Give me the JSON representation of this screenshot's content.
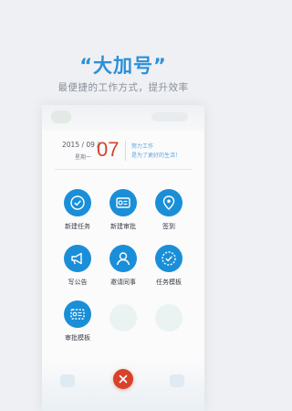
{
  "header": {
    "title": "“大加号”",
    "subtitle": "最便捷的工作方式，提升效率"
  },
  "date": {
    "year_month": "2015 / 09 /",
    "weekday": "星期一",
    "day": "07",
    "motto_line1": "努力工作",
    "motto_line2": "是为了更好的生活！"
  },
  "actions": [
    {
      "label": "新建任务",
      "icon": "check-circle-icon"
    },
    {
      "label": "新建审批",
      "icon": "approval-card-icon"
    },
    {
      "label": "签到",
      "icon": "location-pin-icon"
    },
    {
      "label": "写公告",
      "icon": "megaphone-icon"
    },
    {
      "label": "邀请同事",
      "icon": "person-icon"
    },
    {
      "label": "任务模板",
      "icon": "dashed-check-icon"
    },
    {
      "label": "审批模板",
      "icon": "dashed-card-icon"
    }
  ],
  "colors": {
    "accent": "#1a8fd8",
    "title": "#2b90d9",
    "date_red": "#d6432a",
    "close": "#d6432a"
  },
  "close_button": {
    "icon": "close-icon"
  }
}
